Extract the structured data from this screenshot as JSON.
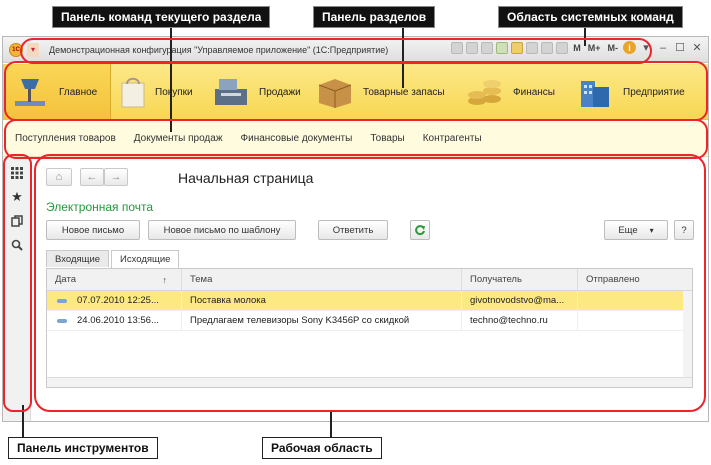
{
  "annotations": {
    "current_section_panel": "Панель команд текущего раздела",
    "sections_panel": "Панель разделов",
    "system_commands": "Область системных команд",
    "tools_panel": "Панель инструментов",
    "work_area": "Рабочая область"
  },
  "window": {
    "title": "Демонстрационная конфигурация \"Управляемое приложение\" (1С:Предприятие)",
    "logo": "1С",
    "sys_text": [
      "M",
      "M+",
      "M-"
    ],
    "info": "i"
  },
  "sections": [
    {
      "label": "Главное",
      "icon": "desk-lamp-icon",
      "active": true
    },
    {
      "label": "Покупки",
      "icon": "shopping-bag-icon"
    },
    {
      "label": "Продажи",
      "icon": "cash-register-icon"
    },
    {
      "label": "Товарные запасы",
      "icon": "box-icon"
    },
    {
      "label": "Финансы",
      "icon": "coins-icon"
    },
    {
      "label": "Предприятие",
      "icon": "building-icon"
    }
  ],
  "section_commands": [
    "Поступления товаров",
    "Документы продаж",
    "Финансовые документы",
    "Товары",
    "Контрагенты"
  ],
  "workspace": {
    "page_title": "Начальная страница",
    "mail_title": "Электронная почта",
    "buttons": {
      "new_letter": "Новое письмо",
      "new_from_template": "Новое письмо по шаблону",
      "reply": "Ответить",
      "more": "Еще",
      "help": "?"
    },
    "tabs": [
      "Входящие",
      "Исходящие"
    ],
    "columns": [
      "Дата",
      "Тема",
      "Получатель",
      "Отправлено"
    ],
    "rows": [
      {
        "date": "07.07.2010 12:25...",
        "subject": "Поставка молока",
        "recipient": "givotnovodstvo@ma...",
        "sent": ""
      },
      {
        "date": "24.06.2010 13:56...",
        "subject": "Предлагаем телевизоры Sony K3456P со скидкой",
        "recipient": "techno@techno.ru",
        "sent": ""
      }
    ]
  },
  "colors": {
    "accent_yellow": "#f7d752",
    "annotation_red": "#e8262c",
    "mail_green": "#1f9a3a"
  }
}
